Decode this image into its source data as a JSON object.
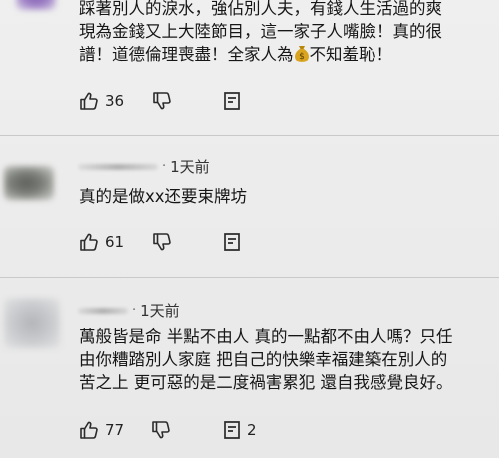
{
  "comments": [
    {
      "lines": [
        "踩著別人的淚水，強佔別人夫，有錢人生活過的爽",
        "現為金錢又上大陸節目，這一家子人嘴臉！真的很",
        "譜！道德倫理喪盡！全家人為",
        "不知羞恥！"
      ],
      "emoji": "money-bag",
      "likes": "36"
    },
    {
      "time": "1天前",
      "text": "真的是做xx还要束牌坊",
      "likes": "61"
    },
    {
      "time": "1天前",
      "lines": [
        "萬般皆是命 半點不由人 真的一點都不由人嗎？只任",
        "由你糟踏別人家庭 把自己的快樂幸福建築在別人的",
        "苦之上  更可惡的是二度禍害累犯 還自我感覺良好。"
      ],
      "likes": "77",
      "replies": "2"
    }
  ],
  "colors": {
    "text": "#161616",
    "icon": "#2b2b2b",
    "divider": "#c9c9c9"
  }
}
